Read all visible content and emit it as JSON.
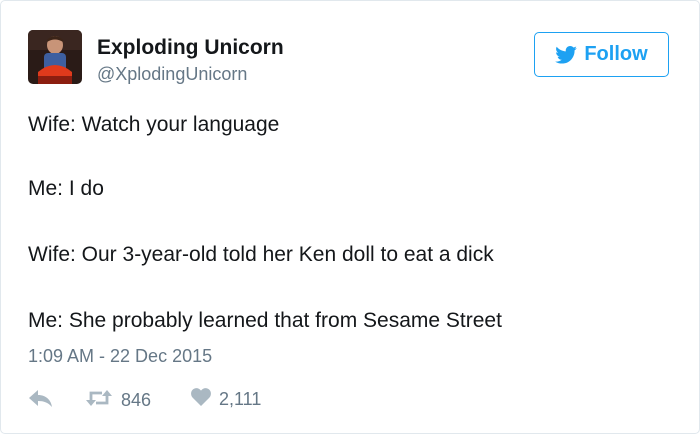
{
  "user": {
    "display_name": "Exploding Unicorn",
    "handle": "@XplodingUnicorn"
  },
  "follow_button": {
    "label": "Follow"
  },
  "tweet": {
    "lines": [
      "Wife: Watch your language",
      "Me: I do",
      "Wife: Our 3-year-old told her Ken doll to eat a dick",
      "Me: She probably learned that from Sesame Street"
    ],
    "timestamp": "1:09 AM - 22 Dec 2015"
  },
  "actions": {
    "retweet_count": "846",
    "like_count": "2,111"
  },
  "colors": {
    "accent": "#1da1f2",
    "text": "#14171a",
    "secondary": "#657786",
    "icon": "#aab8c2"
  },
  "icons": [
    "twitter-bird-icon",
    "reply-icon",
    "retweet-icon",
    "heart-icon"
  ]
}
